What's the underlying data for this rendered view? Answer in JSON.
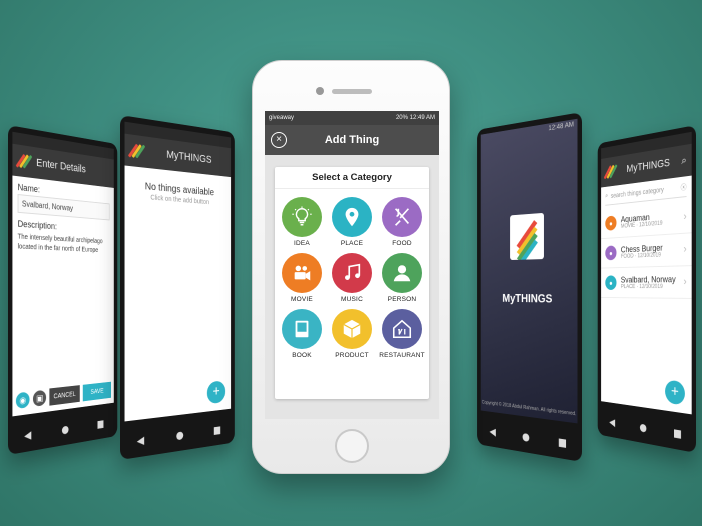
{
  "background": "#3f8f82",
  "left_phone_details": {
    "header_title": "Enter Details",
    "name_label": "Name:",
    "name_value": "Svalbard, Norway",
    "description_label": "Description:",
    "description_value": "The intensely beautiful archipelago located in the far north of Europe",
    "save_label": "SAVE",
    "cancel_label": "CANCEL"
  },
  "left_phone_empty": {
    "header_title": "MyTHINGS",
    "empty_title": "No things available",
    "empty_subtitle": "Click on the add button",
    "fab": "+"
  },
  "center_phone": {
    "status_left": "giveaway",
    "status_right": "20%  12:49 AM",
    "header_title": "Add Thing",
    "close_icon": "×",
    "card_title": "Select a Category",
    "categories": [
      {
        "label": "IDEA",
        "color": "#6ab04c",
        "icon": "lightbulb-icon"
      },
      {
        "label": "PLACE",
        "color": "#2bb3c4",
        "icon": "map-pin-icon"
      },
      {
        "label": "FOOD",
        "color": "#9b6bc4",
        "icon": "fork-knife-icon"
      },
      {
        "label": "MOVIE",
        "color": "#ee7d24",
        "icon": "movie-camera-icon"
      },
      {
        "label": "MUSIC",
        "color": "#d23a4a",
        "icon": "music-note-icon"
      },
      {
        "label": "PERSON",
        "color": "#4ea35c",
        "icon": "person-icon"
      },
      {
        "label": "BOOK",
        "color": "#3ab4c4",
        "icon": "book-icon"
      },
      {
        "label": "PRODUCT",
        "color": "#f2c02c",
        "icon": "box-icon"
      },
      {
        "label": "RESTAURANT",
        "color": "#5b5f9f",
        "icon": "restaurant-icon"
      }
    ]
  },
  "right_phone_splash": {
    "status_time": "12:48 AM",
    "app_name": "MyTHINGS",
    "copyright": "Copyright © 2018 Abdul Rahman. All rights reserved."
  },
  "right_phone_list": {
    "header_title": "MyTHINGS",
    "search_placeholder": "search things category",
    "items": [
      {
        "name": "Aquaman",
        "meta": "MOVIE · 12/10/2019",
        "color": "#ee7d24"
      },
      {
        "name": "Chess Burger",
        "meta": "FOOD · 12/10/2019",
        "color": "#9b6bc4"
      },
      {
        "name": "Svalbard, Norway",
        "meta": "PLACE · 12/10/2019",
        "color": "#2bb3c4"
      }
    ],
    "fab": "+"
  }
}
